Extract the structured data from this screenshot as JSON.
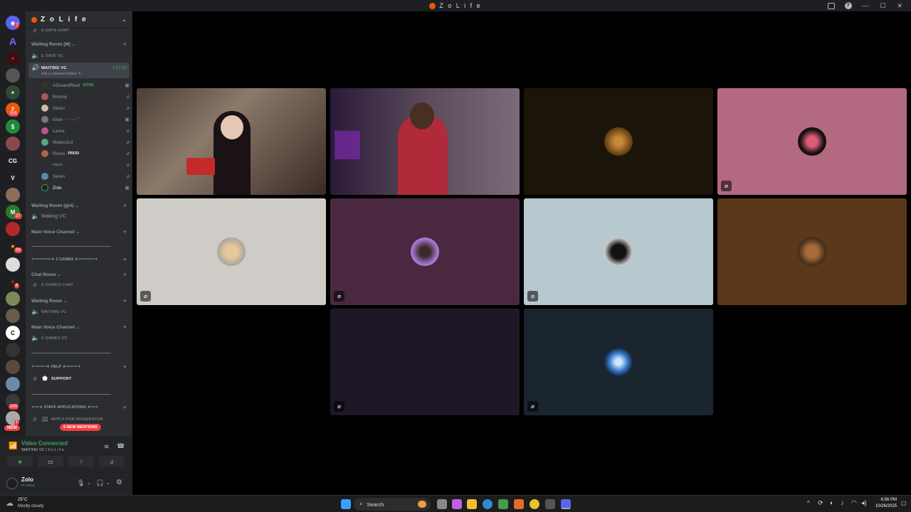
{
  "window": {
    "title": "Z o L i f e"
  },
  "rail": {
    "badges": [
      "7",
      "595",
      "27",
      "99",
      "6",
      "249",
      "1"
    ],
    "new_label": "NEW",
    "initials": [
      "CG",
      "V"
    ]
  },
  "server": {
    "name": "Z o L i f e"
  },
  "sidebar": {
    "top_channel": "E-DATE-CHAT",
    "cat_waiting_m": "Waiting Room (M)",
    "ch_edate_vc": "E DATE VC",
    "active_channel": "WAITING VC",
    "active_timer": "1:67:53",
    "active_status": "Set a channel status",
    "members": [
      {
        "name": "ADoseofReel",
        "tag": "DOSE"
      },
      {
        "name": "Boomy",
        "tag": ""
      },
      {
        "name": "Gloso",
        "tag": ""
      },
      {
        "name": "kiran ·-·°·~·♡",
        "tag": ""
      },
      {
        "name": "Laura",
        "tag": ""
      },
      {
        "name": "Mateo2Lit",
        "tag": ""
      },
      {
        "name": "Romo",
        "tag": "PROD"
      },
      {
        "name": "royce",
        "tag": ""
      },
      {
        "name": "Seren",
        "tag": ""
      },
      {
        "name": "Zolo",
        "tag": ""
      }
    ],
    "cat_waiting_girl": "Waiting Room (girl)",
    "ch_waiting_vc": "Waiting VC",
    "cat_main_voice_1": "Main Voice Channel",
    "cat_z_games": "✦━━━━━━━★ Z GAMES ★━━━━━━━✦",
    "cat_chat_room": "Chat Room",
    "ch_z_games_chat": "Z-GAMES-CHAT",
    "cat_waiting_room": "Waiting Room",
    "ch_waiting_vc_2": "WAITING VC",
    "cat_main_voice_2": "Main Voice Channel",
    "ch_z_games_vc": "Z GAMES VC",
    "cat_help": "✦━━━━━★ HELP ★━━━━━✦",
    "ch_support": "SUPPORT",
    "cat_staff": "✦━━★ STAFF APPLICATIONS ★━━✦",
    "ch_apply": "APPLY-FOR-MODERATOR",
    "new_mentions": "6 NEW MENTIONS"
  },
  "voice": {
    "status": "Video Connected",
    "location": "WAITING VC / Z o L i f e"
  },
  "user": {
    "name": "Zolo",
    "status": "In voice"
  },
  "tiles": [
    {
      "id": "video-1",
      "bg": "#6b5a4c"
    },
    {
      "id": "video-2",
      "bg": "#3a2a3d"
    },
    {
      "id": "lion",
      "bg": "#1a1508"
    },
    {
      "id": "pink",
      "bg": "#b36a80"
    },
    {
      "id": "dog",
      "bg": "#cfccc7"
    },
    {
      "id": "purple",
      "bg": "#4a2940"
    },
    {
      "id": "mask",
      "bg": "#b8c8cf"
    },
    {
      "id": "brown",
      "bg": "#5a3718"
    },
    {
      "id": "dark-purple",
      "bg": "#1e1826"
    },
    {
      "id": "blue",
      "bg": "#1a2530"
    }
  ],
  "taskbar": {
    "weather_temp": "25°C",
    "weather_desc": "Mostly cloudy",
    "search_label": "Search",
    "time": "6:56 PM",
    "date": "10/26/2025"
  },
  "colors": {
    "accent_green": "#3ba55d",
    "mention_red": "#f23f43",
    "brand_orange": "#e8590c"
  }
}
